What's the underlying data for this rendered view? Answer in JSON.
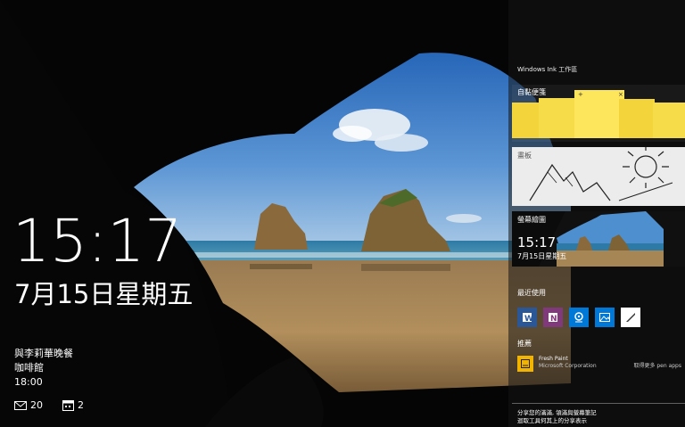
{
  "lockscreen": {
    "time": "15:17",
    "date": "7月15日星期五",
    "event": {
      "title": "與李莉華晚餐",
      "location": "咖啡館",
      "time": "18:00"
    },
    "badges": [
      {
        "icon": "mail-icon",
        "count": "20"
      },
      {
        "icon": "calendar-icon",
        "count": "2"
      }
    ]
  },
  "ink_workspace": {
    "title": "Windows Ink 工作區",
    "sticky_notes_label": "自黏便箋",
    "sketchpad_label": "畫板",
    "screen_sketch_label": "螢幕繪圖",
    "screen_sketch_preview": {
      "time": "15:17",
      "date": "7月15日星期五"
    },
    "recent_label": "最近使用",
    "recent_apps": [
      {
        "name": "word-app-icon",
        "color": "#2b5797"
      },
      {
        "name": "onenote-app-icon",
        "color": "#80397b"
      },
      {
        "name": "maps-app-icon",
        "color": "#0078d7"
      },
      {
        "name": "photos-app-icon",
        "color": "#0078d7"
      },
      {
        "name": "fresh-paint-app-icon",
        "color": "#ffffff"
      }
    ],
    "suggested_label": "推薦",
    "suggested_app": {
      "name": "Fresh Paint",
      "publisher": "Microsoft Corporation",
      "more": "取得更多 pen apps"
    },
    "footer_line1": "分享您的滿滿, 領滿與螢幕筆記",
    "footer_line2": "迴取工具何其上的分享表示"
  }
}
